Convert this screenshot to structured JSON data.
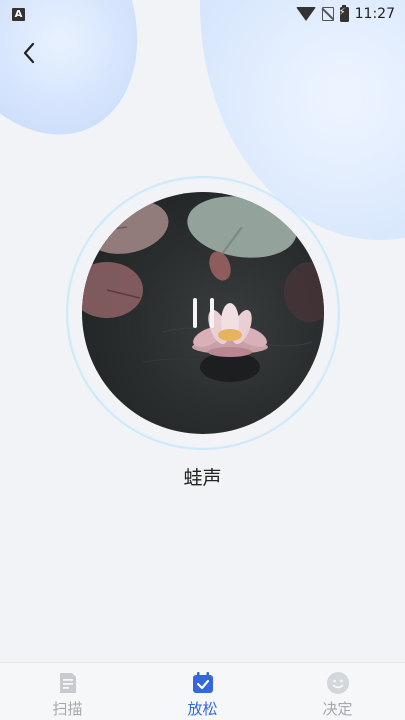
{
  "status_bar": {
    "notification_icon": "a-icon",
    "time": "11:27"
  },
  "header": {
    "back_icon": "chevron-left-icon"
  },
  "player": {
    "track_name": "蛙声",
    "state": "playing",
    "control_icon": "pause-icon"
  },
  "tabbar": {
    "items": [
      {
        "label": "扫描",
        "icon": "document-icon",
        "active": false
      },
      {
        "label": "放松",
        "icon": "calendar-check-icon",
        "active": true
      },
      {
        "label": "决定",
        "icon": "smiley-icon",
        "active": false
      }
    ]
  },
  "colors": {
    "accent": "#3466e0",
    "inactive": "#a5a9ae",
    "ring": "#cfe9f9"
  }
}
